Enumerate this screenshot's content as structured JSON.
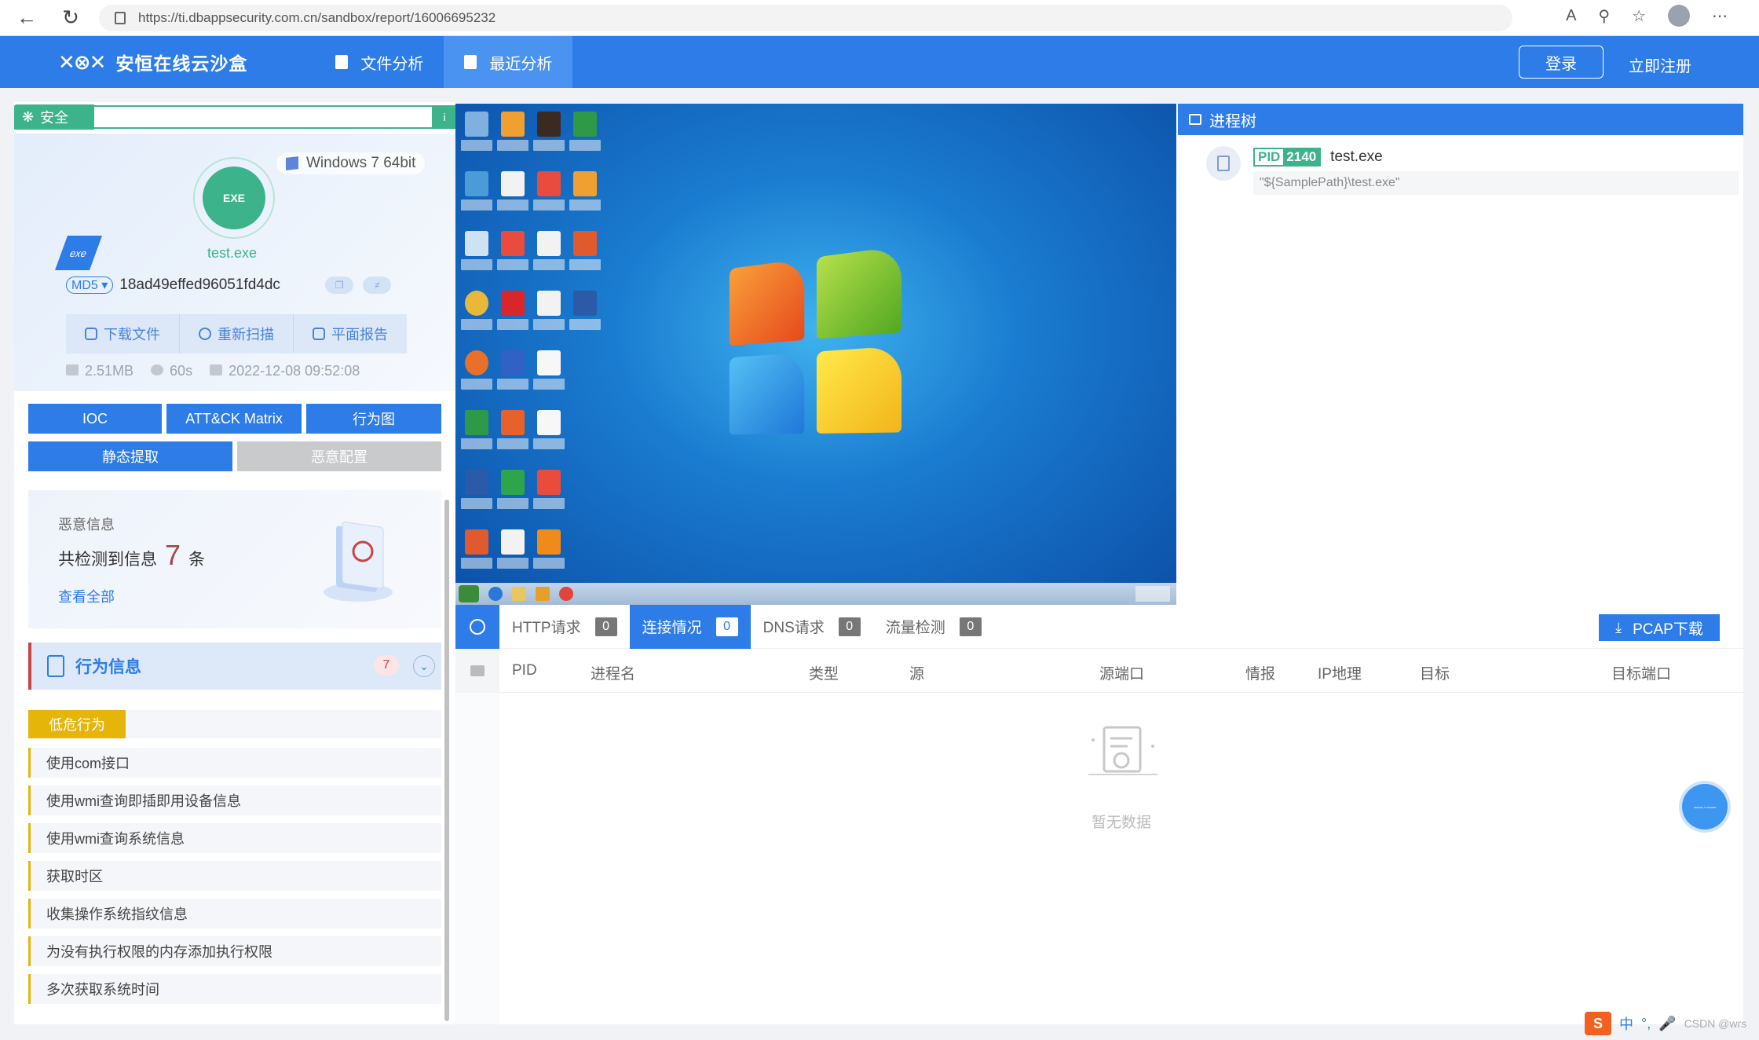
{
  "browser": {
    "url": "https://ti.dbappsecurity.com.cn/sandbox/report/16006695232"
  },
  "topnav": {
    "logo_text": "安恒在线云沙盒",
    "items": [
      {
        "label": "文件分析"
      },
      {
        "label": "最近分析"
      }
    ],
    "login_label": "登录",
    "register_label": "立即注册"
  },
  "status": {
    "label": "安全",
    "color": "#3db38b"
  },
  "file": {
    "name": "test.exe",
    "type_badge": "exe",
    "os": "Windows 7 64bit",
    "hash_type": "MD5",
    "hash_value": "18ad49effed96051fd4dc",
    "size": "2.51MB",
    "duration": "60s",
    "date": "2022-12-08 09:52:08"
  },
  "file_actions": [
    {
      "label": "下载文件"
    },
    {
      "label": "重新扫描"
    },
    {
      "label": "平面报告"
    }
  ],
  "report_tabs_row1": [
    {
      "label": "IOC"
    },
    {
      "label": "ATT&CK Matrix"
    },
    {
      "label": "行为图"
    }
  ],
  "report_tabs_row2": [
    {
      "label": "静态提取"
    },
    {
      "label": "恶意配置"
    }
  ],
  "malice": {
    "title": "恶意信息",
    "prefix": "共检测到信息",
    "count": "7",
    "suffix": "条",
    "view_all": "查看全部"
  },
  "behavior": {
    "title": "行为信息",
    "count": "7",
    "risk_label": "低危行为",
    "items": [
      "使用com接口",
      "使用wmi查询即插即用设备信息",
      "使用wmi查询系统信息",
      "获取时区",
      "收集操作系统指纹信息",
      "为没有执行权限的内存添加执行权限",
      "多次获取系统时间"
    ]
  },
  "process_tree": {
    "title": "进程树",
    "pid_label": "PID",
    "pid": "2140",
    "process_name": "test.exe",
    "command_line": "\"${SamplePath}\\test.exe\""
  },
  "network": {
    "tabs": [
      {
        "label": "HTTP请求",
        "count": "0"
      },
      {
        "label": "连接情况",
        "count": "0"
      },
      {
        "label": "DNS请求",
        "count": "0"
      },
      {
        "label": "流量检测",
        "count": "0"
      }
    ],
    "pcap_label": "PCAP下载",
    "columns": [
      "PID",
      "进程名",
      "类型",
      "源",
      "源端口",
      "情报",
      "IP地理",
      "目标",
      "目标端口"
    ],
    "empty_text": "暂无数据"
  },
  "tray": {
    "ime": "中",
    "watermark": "CSDN @wrs"
  }
}
